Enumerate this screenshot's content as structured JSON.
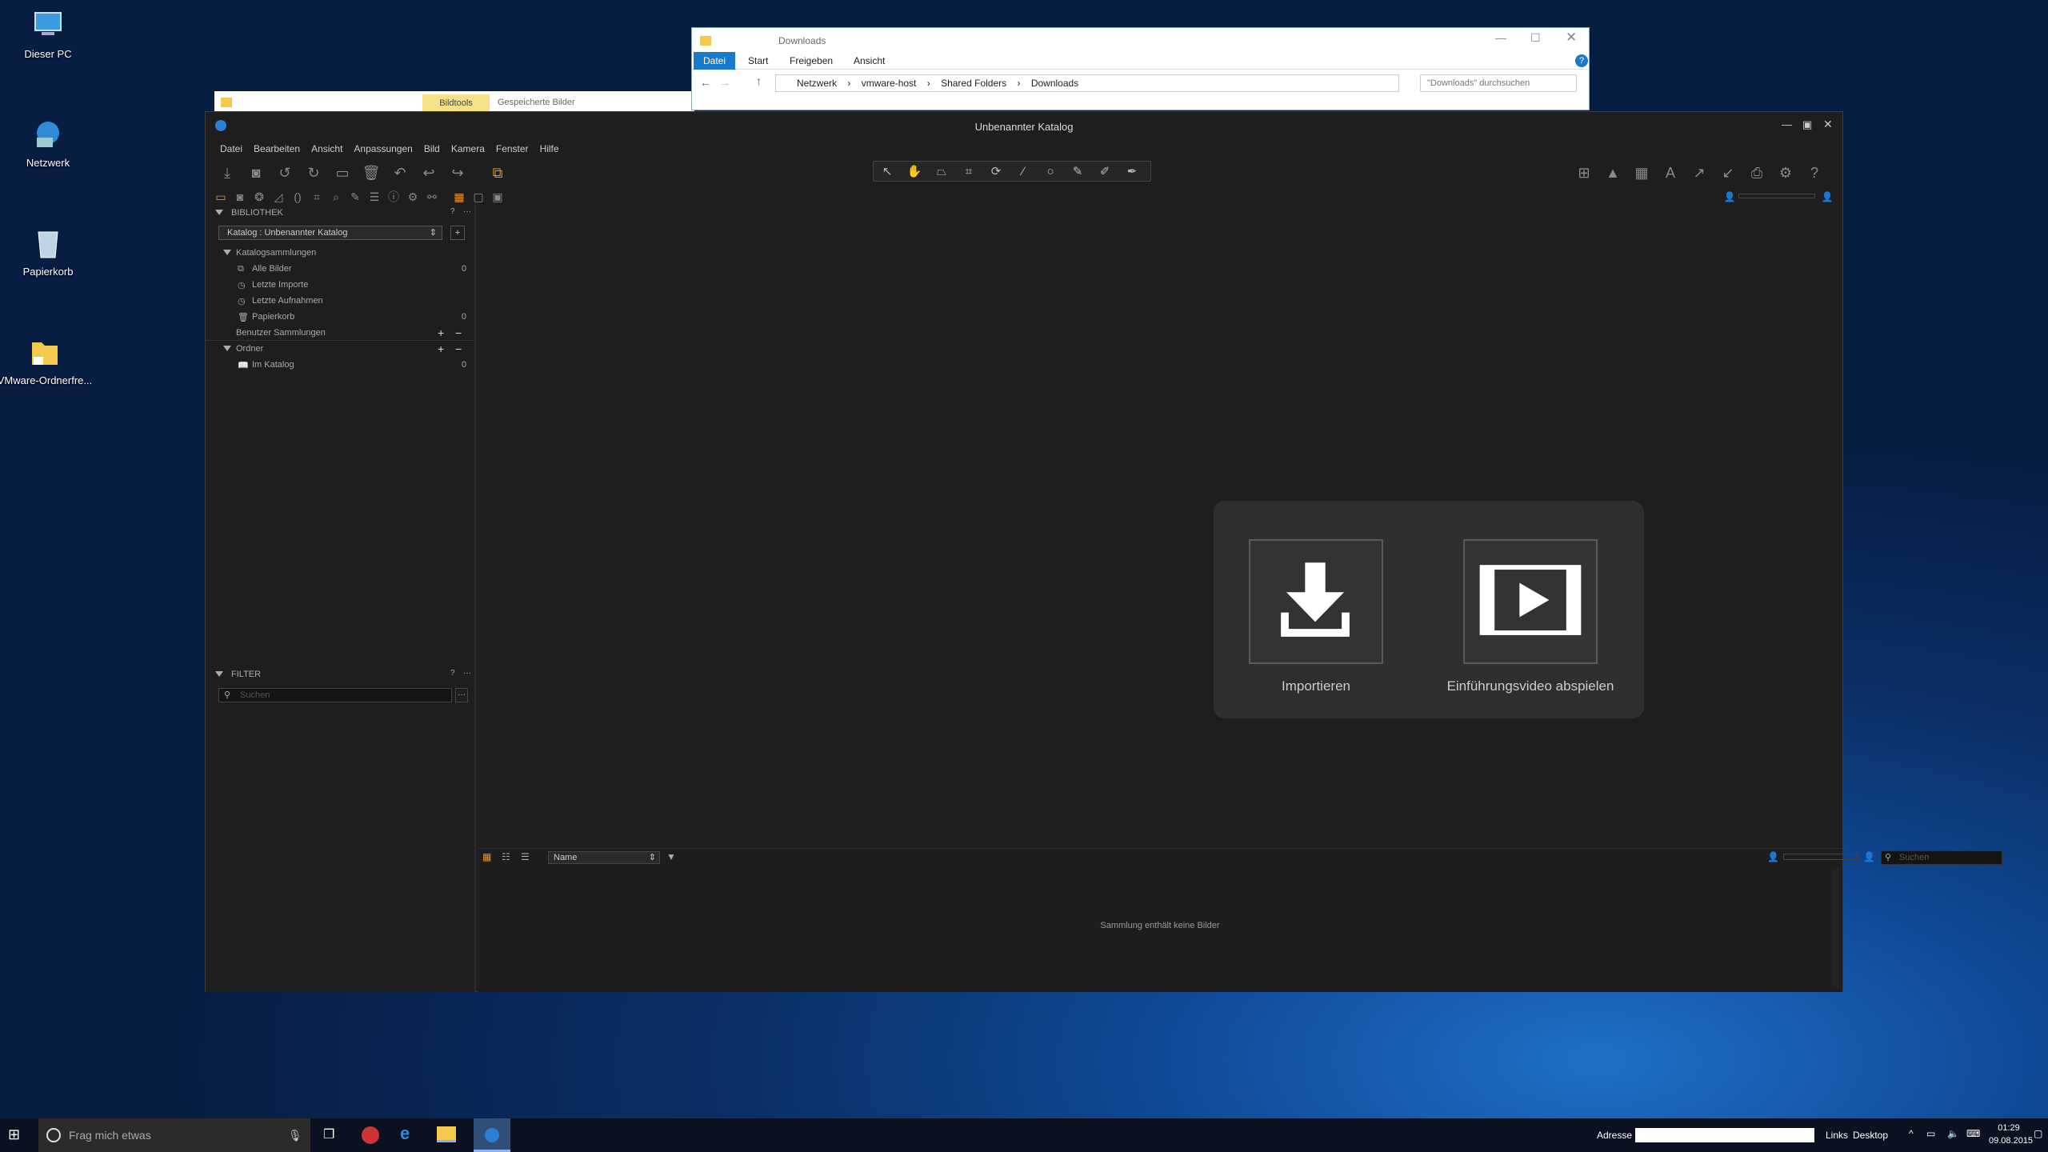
{
  "desktop": {
    "icons": [
      {
        "label": "Dieser PC",
        "icon": "pc-icon"
      },
      {
        "label": "Netzwerk",
        "icon": "network-icon"
      },
      {
        "label": "Papierkorb",
        "icon": "recycle-bin-icon"
      },
      {
        "label": "VMware-Ordnerfre...",
        "icon": "folder-shortcut-icon"
      }
    ]
  },
  "explorer": {
    "title": "Downloads",
    "ribbon_tabs": [
      "Datei",
      "Start",
      "Freigeben",
      "Ansicht"
    ],
    "path": [
      "Netzwerk",
      "vmware-host",
      "Shared Folders",
      "Downloads"
    ],
    "search_placeholder": "\"Downloads\" durchsuchen"
  },
  "explorer2": {
    "tab_active": "Bildtools",
    "tab_label": "Gespeicherte Bilder"
  },
  "app": {
    "title": "Unbenannter Katalog",
    "menu": [
      "Datei",
      "Bearbeiten",
      "Ansicht",
      "Anpassungen",
      "Bild",
      "Kamera",
      "Fenster",
      "Hilfe"
    ],
    "library": {
      "header": "BIBLIOTHEK",
      "catalog_select": "Katalog : Unbenannter Katalog",
      "catalog_collections": "Katalogsammlungen",
      "items": [
        {
          "label": "Alle Bilder",
          "count": "0"
        },
        {
          "label": "Letzte Importe",
          "count": ""
        },
        {
          "label": "Letzte Aufnahmen",
          "count": ""
        },
        {
          "label": "Papierkorb",
          "count": "0"
        }
      ],
      "user_collections": "Benutzer Sammlungen",
      "folders": "Ordner",
      "in_catalog": {
        "label": "Im Katalog",
        "count": "0"
      }
    },
    "filter": {
      "header": "FILTER",
      "search_placeholder": "Suchen"
    },
    "welcome": {
      "import_label": "Importieren",
      "video_label": "Einführungsvideo abspielen"
    },
    "browser": {
      "sort": "Name",
      "search_placeholder": "Suchen",
      "empty_message": "Sammlung enthält keine Bilder"
    }
  },
  "taskbar": {
    "search_placeholder": "Frag mich etwas",
    "address_label": "Adresse",
    "links": "Links",
    "desktop": "Desktop",
    "time": "01:29",
    "date": "09.08.2015"
  },
  "colors": {
    "accent": "#e8922a",
    "windows_blue": "#1979ca"
  }
}
